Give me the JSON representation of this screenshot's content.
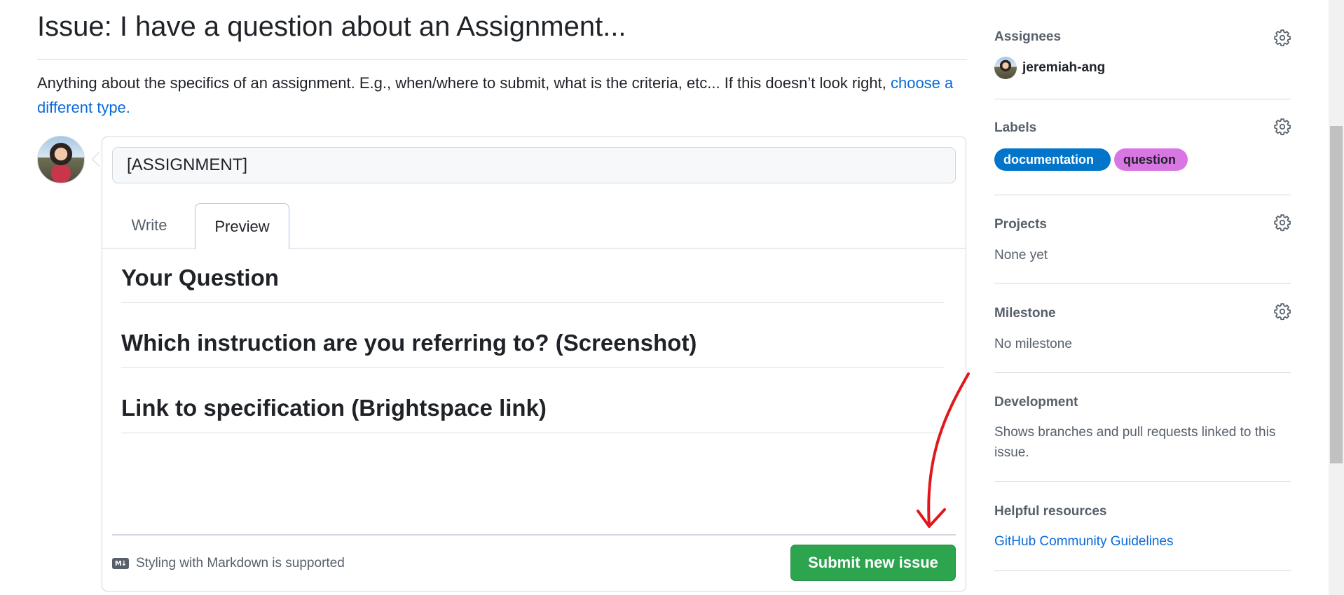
{
  "issue": {
    "title": "Issue: I have a question about an Assignment...",
    "description": "Anything about the specifics of an assignment. E.g., when/where to submit, what is the criteria, etc... If this doesn’t look right,",
    "change_type_link": "choose a different type."
  },
  "composer": {
    "title_value": "[ASSIGNMENT]",
    "tabs": [
      {
        "label": "Write",
        "active": false
      },
      {
        "label": "Preview",
        "active": true
      }
    ],
    "preview_headings": [
      "Your Question",
      "Which instruction are you referring to? (Screenshot)",
      "Link to specification (Brightspace link)"
    ],
    "markdown_hint": "Styling with Markdown is supported",
    "markdown_icon": "markdown-icon",
    "submit_label": "Submit new issue",
    "submit_color": "#2da44e"
  },
  "sidebar": {
    "assignees": {
      "heading": "Assignees",
      "user": "jeremiah-ang"
    },
    "labels": {
      "heading": "Labels",
      "items": [
        {
          "name": "documentation",
          "bg": "#0075ca",
          "fg": "#ffffff"
        },
        {
          "name": "question",
          "bg": "#d876e3",
          "fg": "#1f2328"
        }
      ]
    },
    "projects": {
      "heading": "Projects",
      "value": "None yet"
    },
    "milestone": {
      "heading": "Milestone",
      "value": "No milestone"
    },
    "development": {
      "heading": "Development",
      "value": "Shows branches and pull requests linked to this issue."
    },
    "helpful_resources": {
      "heading": "Helpful resources",
      "link": "GitHub Community Guidelines"
    },
    "gear_icon": "gear-icon"
  },
  "annotation": {
    "arrow_color": "#e0181c"
  }
}
